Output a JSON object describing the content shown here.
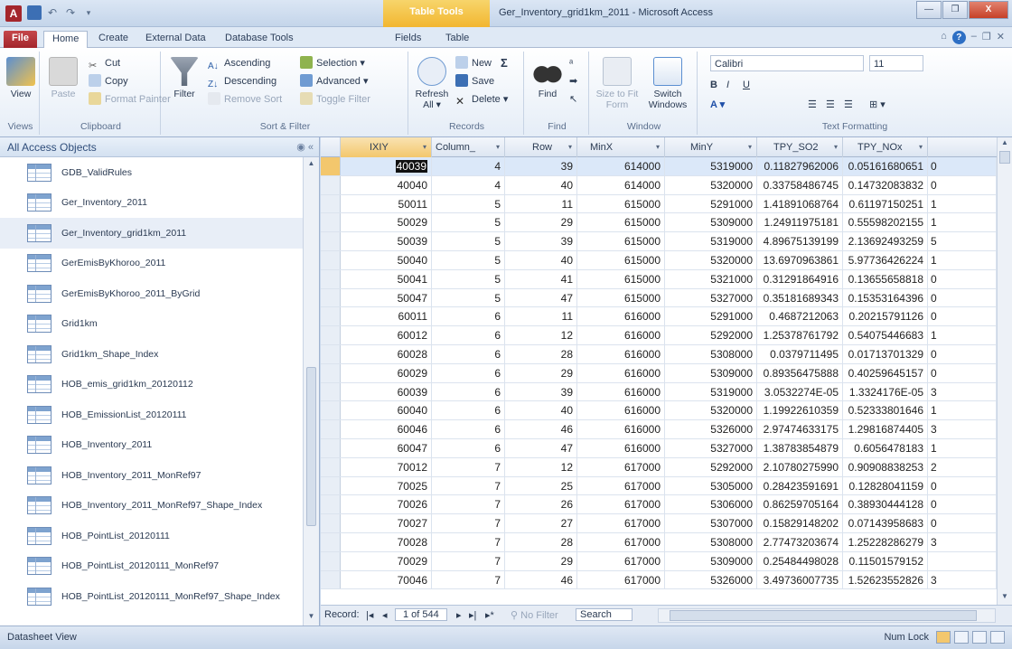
{
  "window": {
    "context_tab": "Table Tools",
    "title": "Ger_Inventory_grid1km_2011 - Microsoft Access",
    "minimize": "—",
    "maximize": "❐",
    "close": "X"
  },
  "ribbon_tabs": [
    "File",
    "Home",
    "Create",
    "External Data",
    "Database Tools",
    "Fields",
    "Table"
  ],
  "ribbon": {
    "views": {
      "view": "View",
      "label": "Views"
    },
    "clipboard": {
      "paste": "Paste",
      "cut": "Cut",
      "copy": "Copy",
      "format_painter": "Format Painter",
      "label": "Clipboard"
    },
    "sort_filter": {
      "filter": "Filter",
      "ascending": "Ascending",
      "descending": "Descending",
      "remove_sort": "Remove Sort",
      "selection": "Selection",
      "advanced": "Advanced",
      "toggle_filter": "Toggle Filter",
      "label": "Sort & Filter"
    },
    "records": {
      "refresh": "Refresh",
      "refresh_sub": "All",
      "new": "New",
      "save": "Save",
      "delete": "Delete",
      "totals": "Σ",
      "label": "Records"
    },
    "find": {
      "find": "Find",
      "label": "Find"
    },
    "window": {
      "size_to_fit": "Size to Fit Form",
      "switch_windows": "Switch Windows",
      "label": "Window"
    },
    "text_formatting": {
      "font": "Calibri",
      "size": "11",
      "bold": "B",
      "italic": "I",
      "underline": "U",
      "label": "Text Formatting"
    }
  },
  "nav": {
    "header": "All Access Objects",
    "items": [
      "GDB_ValidRules",
      "Ger_Inventory_2011",
      "Ger_Inventory_grid1km_2011",
      "GerEmisByKhoroo_2011",
      "GerEmisByKhoroo_2011_ByGrid",
      "Grid1km",
      "Grid1km_Shape_Index",
      "HOB_emis_grid1km_20120112",
      "HOB_EmissionList_20120111",
      "HOB_Inventory_2011",
      "HOB_Inventory_2011_MonRef97",
      "HOB_Inventory_2011_MonRef97_Shape_Index",
      "HOB_PointList_20120111",
      "HOB_PointList_20120111_MonRef97",
      "HOB_PointList_20120111_MonRef97_Shape_Index"
    ],
    "selected_index": 2
  },
  "table": {
    "columns": [
      "IXIY",
      "Column_",
      "Row",
      "MinX",
      "MinY",
      "TPY_SO2",
      "TPY_NOx"
    ],
    "rows": [
      [
        "40039",
        "4",
        "39",
        "614000",
        "5319000",
        "0.11827962006",
        "0.05161680651",
        "0"
      ],
      [
        "40040",
        "4",
        "40",
        "614000",
        "5320000",
        "0.33758486745",
        "0.14732083832",
        "0"
      ],
      [
        "50011",
        "5",
        "11",
        "615000",
        "5291000",
        "1.41891068764",
        "0.61197150251",
        "1"
      ],
      [
        "50029",
        "5",
        "29",
        "615000",
        "5309000",
        "1.24911975181",
        "0.55598202155",
        "1"
      ],
      [
        "50039",
        "5",
        "39",
        "615000",
        "5319000",
        "4.89675139199",
        "2.13692493259",
        "5"
      ],
      [
        "50040",
        "5",
        "40",
        "615000",
        "5320000",
        "13.6970963861",
        "5.97736426224",
        "1"
      ],
      [
        "50041",
        "5",
        "41",
        "615000",
        "5321000",
        "0.31291864916",
        "0.13655658818",
        "0"
      ],
      [
        "50047",
        "5",
        "47",
        "615000",
        "5327000",
        "0.35181689343",
        "0.15353164396",
        "0"
      ],
      [
        "60011",
        "6",
        "11",
        "616000",
        "5291000",
        "0.4687212063",
        "0.20215791126",
        "0"
      ],
      [
        "60012",
        "6",
        "12",
        "616000",
        "5292000",
        "1.25378761792",
        "0.54075446683",
        "1"
      ],
      [
        "60028",
        "6",
        "28",
        "616000",
        "5308000",
        "0.0379711495",
        "0.01713701329",
        "0"
      ],
      [
        "60029",
        "6",
        "29",
        "616000",
        "5309000",
        "0.89356475888",
        "0.40259645157",
        "0"
      ],
      [
        "60039",
        "6",
        "39",
        "616000",
        "5319000",
        "3.0532274E-05",
        "1.3324176E-05",
        "3"
      ],
      [
        "60040",
        "6",
        "40",
        "616000",
        "5320000",
        "1.19922610359",
        "0.52333801646",
        "1"
      ],
      [
        "60046",
        "6",
        "46",
        "616000",
        "5326000",
        "2.97474633175",
        "1.29816874405",
        "3"
      ],
      [
        "60047",
        "6",
        "47",
        "616000",
        "5327000",
        "1.38783854879",
        "0.6056478183",
        "1"
      ],
      [
        "70012",
        "7",
        "12",
        "617000",
        "5292000",
        "2.10780275990",
        "0.90908838253",
        "2"
      ],
      [
        "70025",
        "7",
        "25",
        "617000",
        "5305000",
        "0.28423591691",
        "0.12828041159",
        "0"
      ],
      [
        "70026",
        "7",
        "26",
        "617000",
        "5306000",
        "0.86259705164",
        "0.38930444128",
        "0"
      ],
      [
        "70027",
        "7",
        "27",
        "617000",
        "5307000",
        "0.15829148202",
        "0.07143958683",
        "0"
      ],
      [
        "70028",
        "7",
        "28",
        "617000",
        "5308000",
        "2.77473203674",
        "1.25228286279",
        "3"
      ],
      [
        "70029",
        "7",
        "29",
        "617000",
        "5309000",
        "0.25484498028",
        "0.11501579152",
        ""
      ],
      [
        "70046",
        "7",
        "46",
        "617000",
        "5326000",
        "3.49736007735",
        "1.52623552826",
        "3"
      ]
    ]
  },
  "record_nav": {
    "label": "Record:",
    "position": "1 of 544",
    "no_filter": "No Filter",
    "search": "Search"
  },
  "status": {
    "left": "Datasheet View",
    "num_lock": "Num Lock"
  }
}
